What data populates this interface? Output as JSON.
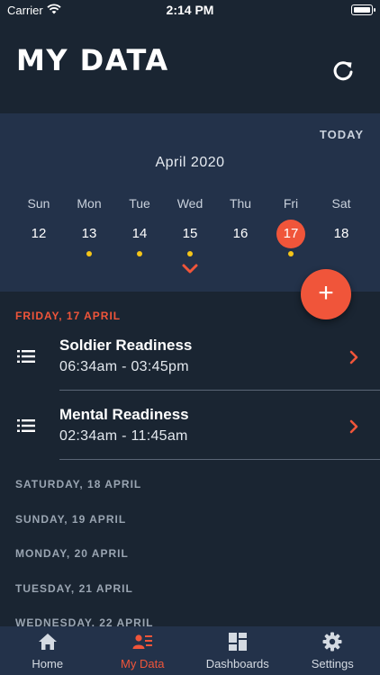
{
  "status_bar": {
    "carrier": "Carrier",
    "time": "2:14 PM"
  },
  "header": {
    "title": "MY DATA",
    "refresh_icon": "refresh-icon"
  },
  "calendar": {
    "today_label": "TODAY",
    "month": "April 2020",
    "weekdays": [
      "Sun",
      "Mon",
      "Tue",
      "Wed",
      "Thu",
      "Fri",
      "Sat"
    ],
    "dates": [
      {
        "day": "12",
        "has_data": false,
        "selected": false
      },
      {
        "day": "13",
        "has_data": true,
        "selected": false
      },
      {
        "day": "14",
        "has_data": true,
        "selected": false
      },
      {
        "day": "15",
        "has_data": true,
        "selected": false
      },
      {
        "day": "16",
        "has_data": false,
        "selected": false
      },
      {
        "day": "17",
        "has_data": true,
        "selected": true
      },
      {
        "day": "18",
        "has_data": false,
        "selected": false
      }
    ],
    "accent_color": "#f0553a",
    "dot_color": "#f5c518"
  },
  "fab": {
    "icon": "plus-icon"
  },
  "selected_day": {
    "label": "FRIDAY, 17 APRIL",
    "entries": [
      {
        "name": "Soldier Readiness",
        "range": "06:34am - 03:45pm"
      },
      {
        "name": "Mental Readiness",
        "range": "02:34am - 11:45am"
      }
    ]
  },
  "other_days": [
    "SATURDAY, 18 APRIL",
    "SUNDAY, 19 APRIL",
    "MONDAY, 20 APRIL",
    "TUESDAY, 21 APRIL",
    "WEDNESDAY, 22 APRIL"
  ],
  "tabs": [
    {
      "label": "Home",
      "icon": "home-icon",
      "active": false
    },
    {
      "label": "My Data",
      "icon": "my-data-icon",
      "active": true
    },
    {
      "label": "Dashboards",
      "icon": "dashboards-icon",
      "active": false
    },
    {
      "label": "Settings",
      "icon": "gear-icon",
      "active": false
    }
  ]
}
